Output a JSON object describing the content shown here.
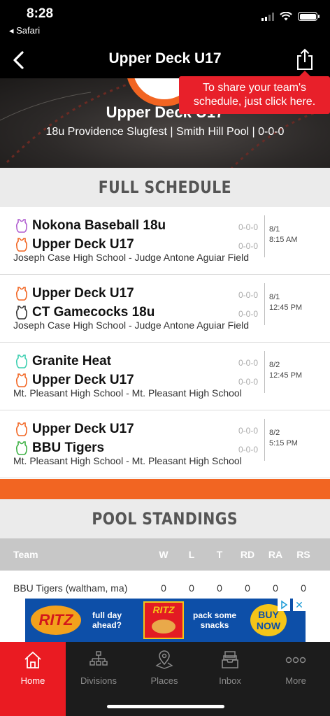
{
  "status_bar": {
    "time": "8:28",
    "back_app": "◂ Safari"
  },
  "nav": {
    "title": "Upper Deck U17"
  },
  "hero": {
    "team_name": "Upper Deck U17",
    "subtitle": "18u Providence Slugfest | Smith Hill Pool | 0-0-0"
  },
  "tooltip": {
    "text": "To share your team's schedule, just click here."
  },
  "schedule": {
    "heading": "FULL SCHEDULE",
    "games": [
      {
        "team1": {
          "name": "Nokona Baseball 18u",
          "score": "0-0-0",
          "color": "#b05fd0"
        },
        "team2": {
          "name": "Upper Deck U17",
          "score": "0-0-0",
          "color": "#f26522"
        },
        "date": "8/1",
        "time": "8:15 AM",
        "venue": "Joseph Case High School - Judge Antone Aguiar Field"
      },
      {
        "team1": {
          "name": "Upper Deck U17",
          "score": "0-0-0",
          "color": "#f26522"
        },
        "team2": {
          "name": "CT Gamecocks 18u",
          "score": "0-0-0",
          "color": "#333333"
        },
        "date": "8/1",
        "time": "12:45 PM",
        "venue": "Joseph Case High School - Judge Antone Aguiar Field"
      },
      {
        "team1": {
          "name": "Granite Heat",
          "score": "0-0-0",
          "color": "#3ccfb0"
        },
        "team2": {
          "name": "Upper Deck U17",
          "score": "0-0-0",
          "color": "#f26522"
        },
        "date": "8/2",
        "time": "12:45 PM",
        "venue": "Mt. Pleasant High School - Mt. Pleasant High School"
      },
      {
        "team1": {
          "name": "Upper Deck U17",
          "score": "0-0-0",
          "color": "#f26522"
        },
        "team2": {
          "name": "BBU Tigers",
          "score": "0-0-0",
          "color": "#3cb043"
        },
        "date": "8/2",
        "time": "5:15 PM",
        "venue": "Mt. Pleasant High School - Mt. Pleasant High School"
      }
    ]
  },
  "standings": {
    "heading": "POOL STANDINGS",
    "columns": [
      "Team",
      "W",
      "L",
      "T",
      "RD",
      "RA",
      "RS"
    ],
    "rows": [
      {
        "team": "BBU Tigers (waltham, ma)",
        "values": [
          "0",
          "0",
          "0",
          "0",
          "0",
          "0"
        ]
      }
    ]
  },
  "ad": {
    "brand": "RITZ",
    "line1a": "full day",
    "line1b": "ahead?",
    "line2a": "pack some",
    "line2b": "snacks",
    "cta_a": "BUY",
    "cta_b": "NOW",
    "close": "✕"
  },
  "tabs": [
    {
      "label": "Home",
      "icon": "home-icon"
    },
    {
      "label": "Divisions",
      "icon": "bracket-icon"
    },
    {
      "label": "Places",
      "icon": "location-pin-icon"
    },
    {
      "label": "Inbox",
      "icon": "inbox-icon"
    },
    {
      "label": "More",
      "icon": "more-dots-icon"
    }
  ],
  "colors": {
    "accent": "#f26522",
    "tab_active": "#ea1b22",
    "tooltip": "#e8202a"
  }
}
